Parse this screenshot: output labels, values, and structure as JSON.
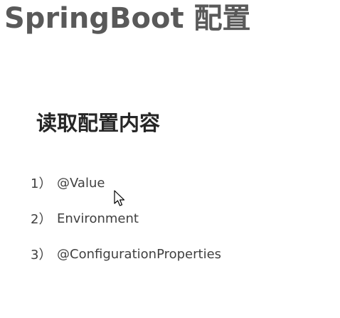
{
  "slide": {
    "title": "SpringBoot 配置",
    "subtitle": "读取配置内容",
    "items": [
      {
        "num": "1）",
        "text": "@Value"
      },
      {
        "num": "2）",
        "text": "Environment"
      },
      {
        "num": "3）",
        "text": "@ConfigurationProperties"
      }
    ]
  },
  "icons": {
    "cursor": "mouse-pointer-icon"
  },
  "colors": {
    "title": "#595959",
    "subtitle": "#262626",
    "list_text": "#404040",
    "background": "#ffffff"
  }
}
